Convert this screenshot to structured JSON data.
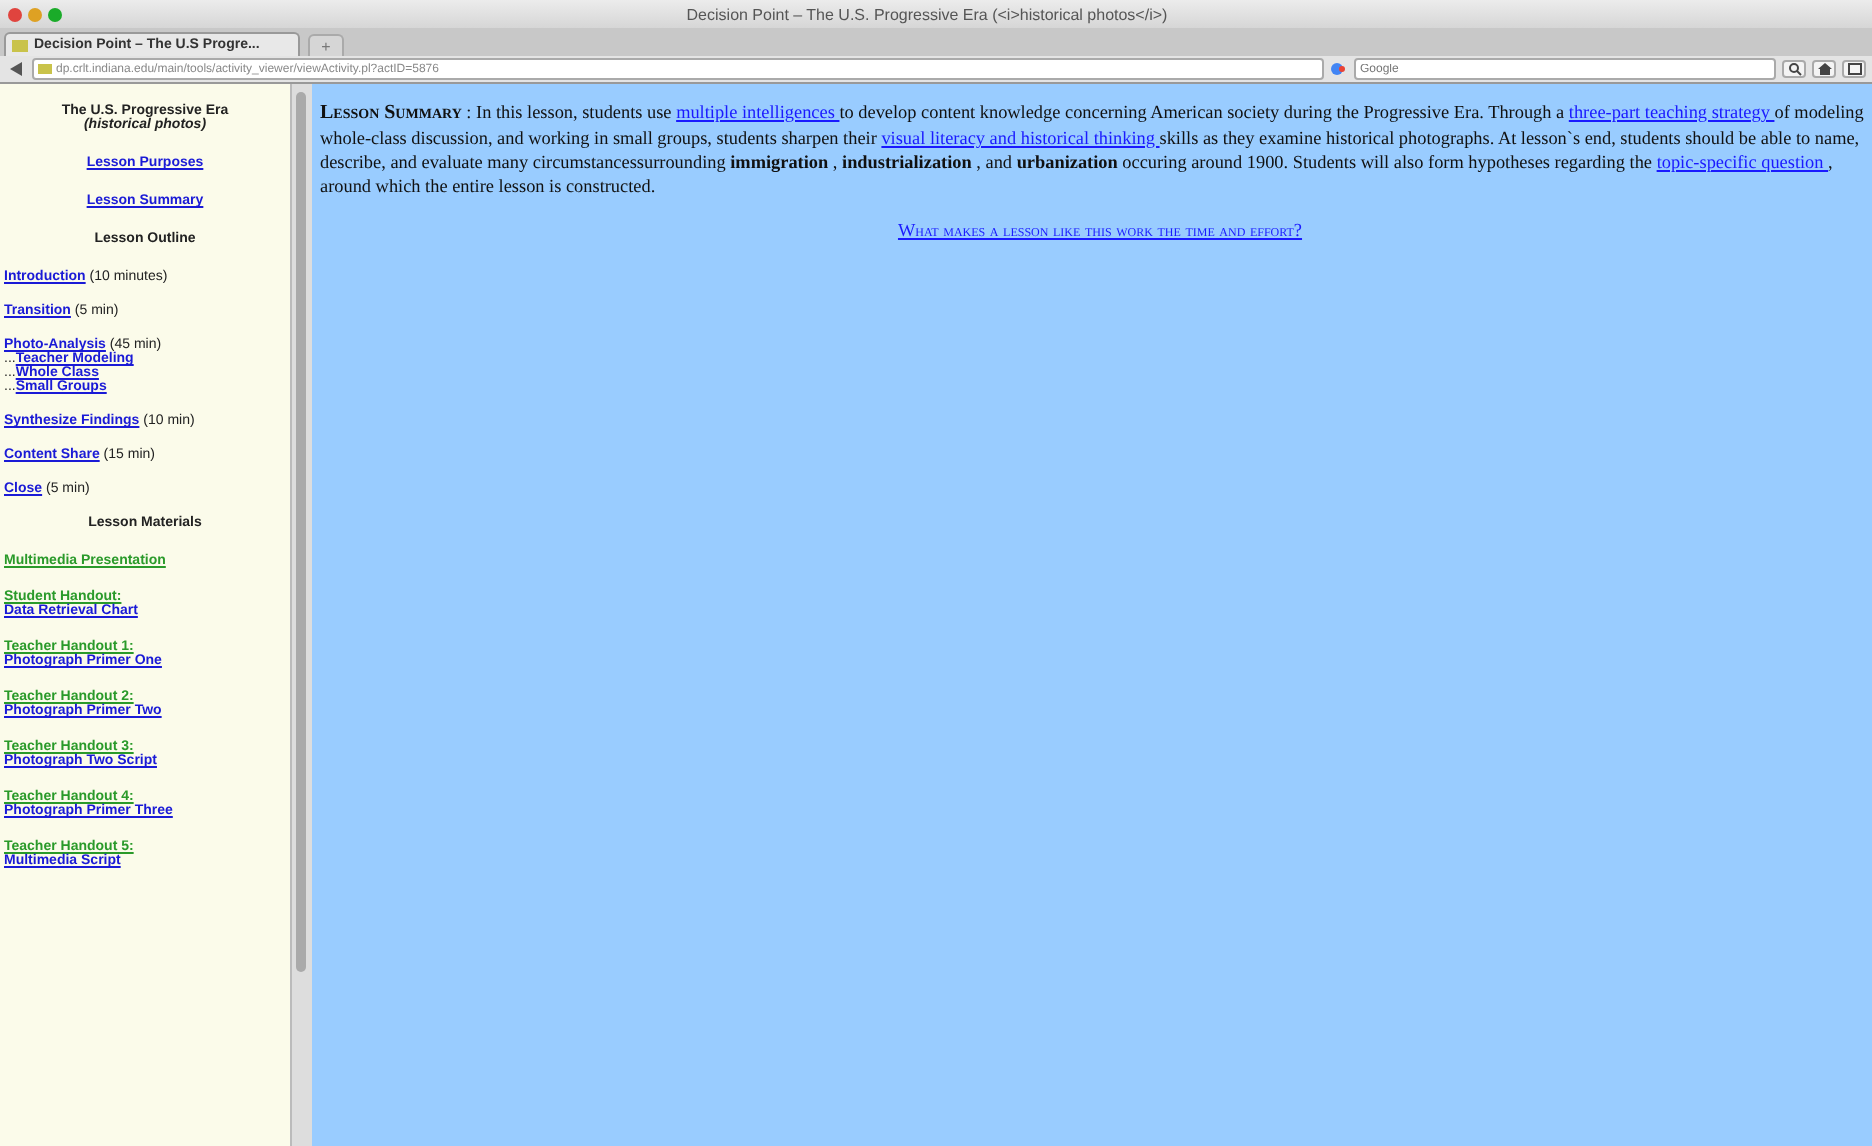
{
  "window": {
    "title": "Decision Point – The U.S. Progressive Era (<i>historical photos</i>)"
  },
  "tabs": [
    {
      "label": "Decision Point – The U.S Progre...",
      "selected": true
    }
  ],
  "new_tab": "+",
  "address_bar": {
    "value": "dp.crlt.indiana.edu/main/tools/activity_viewer/viewActivity.pl?actID=5876"
  },
  "search": {
    "placeholder": "Google"
  },
  "sidebar": {
    "title": "The U.S. Progressive Era",
    "subtitle": "(historical photos)",
    "items": [
      {
        "kind": "center-link",
        "text": "Lesson Purposes"
      },
      {
        "kind": "center-link",
        "text": "Lesson Summary"
      },
      {
        "kind": "heading",
        "text": "Lesson Outline"
      },
      {
        "kind": "outline",
        "text": "Introduction",
        "note": "(10 minutes)"
      },
      {
        "kind": "outline",
        "text": "Transition",
        "note": "(5 min)"
      },
      {
        "kind": "outline",
        "text": "Photo-Analysis",
        "note": "(45 min)",
        "children": [
          {
            "prefix": "...",
            "text": "Teacher Modeling"
          },
          {
            "prefix": "...",
            "text": "Whole Class"
          },
          {
            "prefix": "...",
            "text": "Small Groups"
          }
        ]
      },
      {
        "kind": "outline",
        "text": "Synthesize Findings",
        "note": "(10 min)"
      },
      {
        "kind": "outline",
        "text": "Content Share",
        "note": "(15 min)"
      },
      {
        "kind": "outline",
        "text": "Close",
        "note": "(5 min)"
      },
      {
        "kind": "heading",
        "text": "Lesson Materials"
      },
      {
        "kind": "material",
        "label": "Multimedia Presentation"
      },
      {
        "kind": "material",
        "label": "Student Handout:",
        "text": "Data Retrieval Chart"
      },
      {
        "kind": "material",
        "label": "Teacher Handout 1:",
        "text": "Photograph Primer One"
      },
      {
        "kind": "material",
        "label": "Teacher Handout 2:",
        "text": "Photograph Primer Two"
      },
      {
        "kind": "material",
        "label": "Teacher Handout 3:",
        "text": "Photograph Two Script"
      },
      {
        "kind": "material",
        "label": "Teacher Handout 4:",
        "text": "Photograph Primer Three"
      },
      {
        "kind": "material",
        "label": "Teacher Handout 5:",
        "text": "Multimedia Script"
      }
    ]
  },
  "summary": {
    "segments": [
      {
        "kind": "heading",
        "text": "Lesson Summary"
      },
      {
        "kind": "text",
        "text": " : In this lesson, students use "
      },
      {
        "kind": "link",
        "text": "multiple intelligences "
      },
      {
        "kind": "text",
        "text": "to develop content knowledge concerning American society during the Progressive Era. Through a "
      },
      {
        "kind": "link",
        "text": "three-part teaching strategy "
      },
      {
        "kind": "text",
        "text": "of modeling whole-class discussion, and working in small groups, students sharpen their "
      },
      {
        "kind": "link",
        "text": "visual literacy and historical thinking "
      },
      {
        "kind": "text",
        "text": "skills as they examine historical photographs. At lesson`s end, students should be able to name, describe, and evaluate many circumstancessurrounding "
      },
      {
        "kind": "bold",
        "text": "immigration"
      },
      {
        "kind": "text",
        "text": " , "
      },
      {
        "kind": "bold",
        "text": "industrialization"
      },
      {
        "kind": "text",
        "text": " , and "
      },
      {
        "kind": "bold",
        "text": "urbanization"
      },
      {
        "kind": "text",
        "text": " occuring around 1900. Students will also form hypotheses regarding the "
      },
      {
        "kind": "link",
        "text": "topic-specific question "
      },
      {
        "kind": "text",
        "text": ", around which the entire lesson is constructed."
      }
    ]
  },
  "effort_link": "What makes a lesson like this work the time and effort?"
}
